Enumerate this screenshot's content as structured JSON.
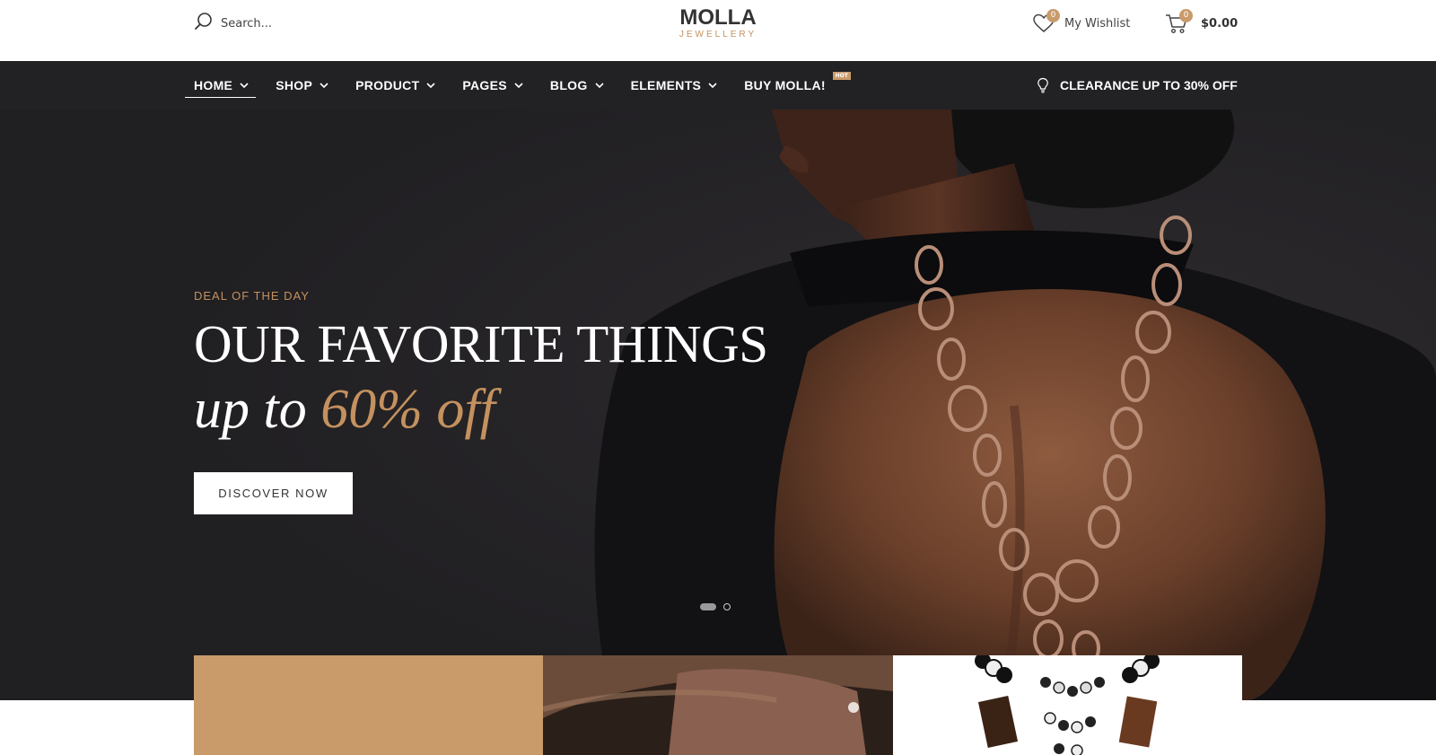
{
  "header": {
    "search_placeholder": "Search...",
    "logo_text": "MOLLA",
    "logo_subtext": "JEWELLERY",
    "wishlist_label": "My Wishlist",
    "wishlist_count": "0",
    "cart_count": "0",
    "cart_total": "$0.00"
  },
  "nav": {
    "items": [
      {
        "label": "HOME",
        "has_dropdown": true,
        "active": true
      },
      {
        "label": "SHOP",
        "has_dropdown": true
      },
      {
        "label": "PRODUCT",
        "has_dropdown": true
      },
      {
        "label": "PAGES",
        "has_dropdown": true
      },
      {
        "label": "BLOG",
        "has_dropdown": true
      },
      {
        "label": "ELEMENTS",
        "has_dropdown": true
      },
      {
        "label": "BUY MOLLA!",
        "has_dropdown": false,
        "badge": "HOT"
      }
    ],
    "promo_label": "CLEARANCE UP TO 30% OFF",
    "promo_icon": "lightbulb-icon"
  },
  "hero": {
    "kicker": "DEAL OF THE DAY",
    "headline": "OUR FAVORITE THINGS",
    "subline_prefix": "up to",
    "subline_accent": "60% off",
    "cta_label": "DISCOVER NOW",
    "slide_count": 2,
    "active_slide": 1
  },
  "icons": {
    "search": "search-icon",
    "wishlist": "heart-icon",
    "cart": "cart-icon",
    "dropdown": "chevron-down-icon"
  },
  "colors": {
    "accent": "#c4915f",
    "nav_background": "#222124",
    "hero_background": "#222124",
    "banner_1": "#c99b6b",
    "badge": "#c99b6b",
    "text_dark": "#333333"
  }
}
